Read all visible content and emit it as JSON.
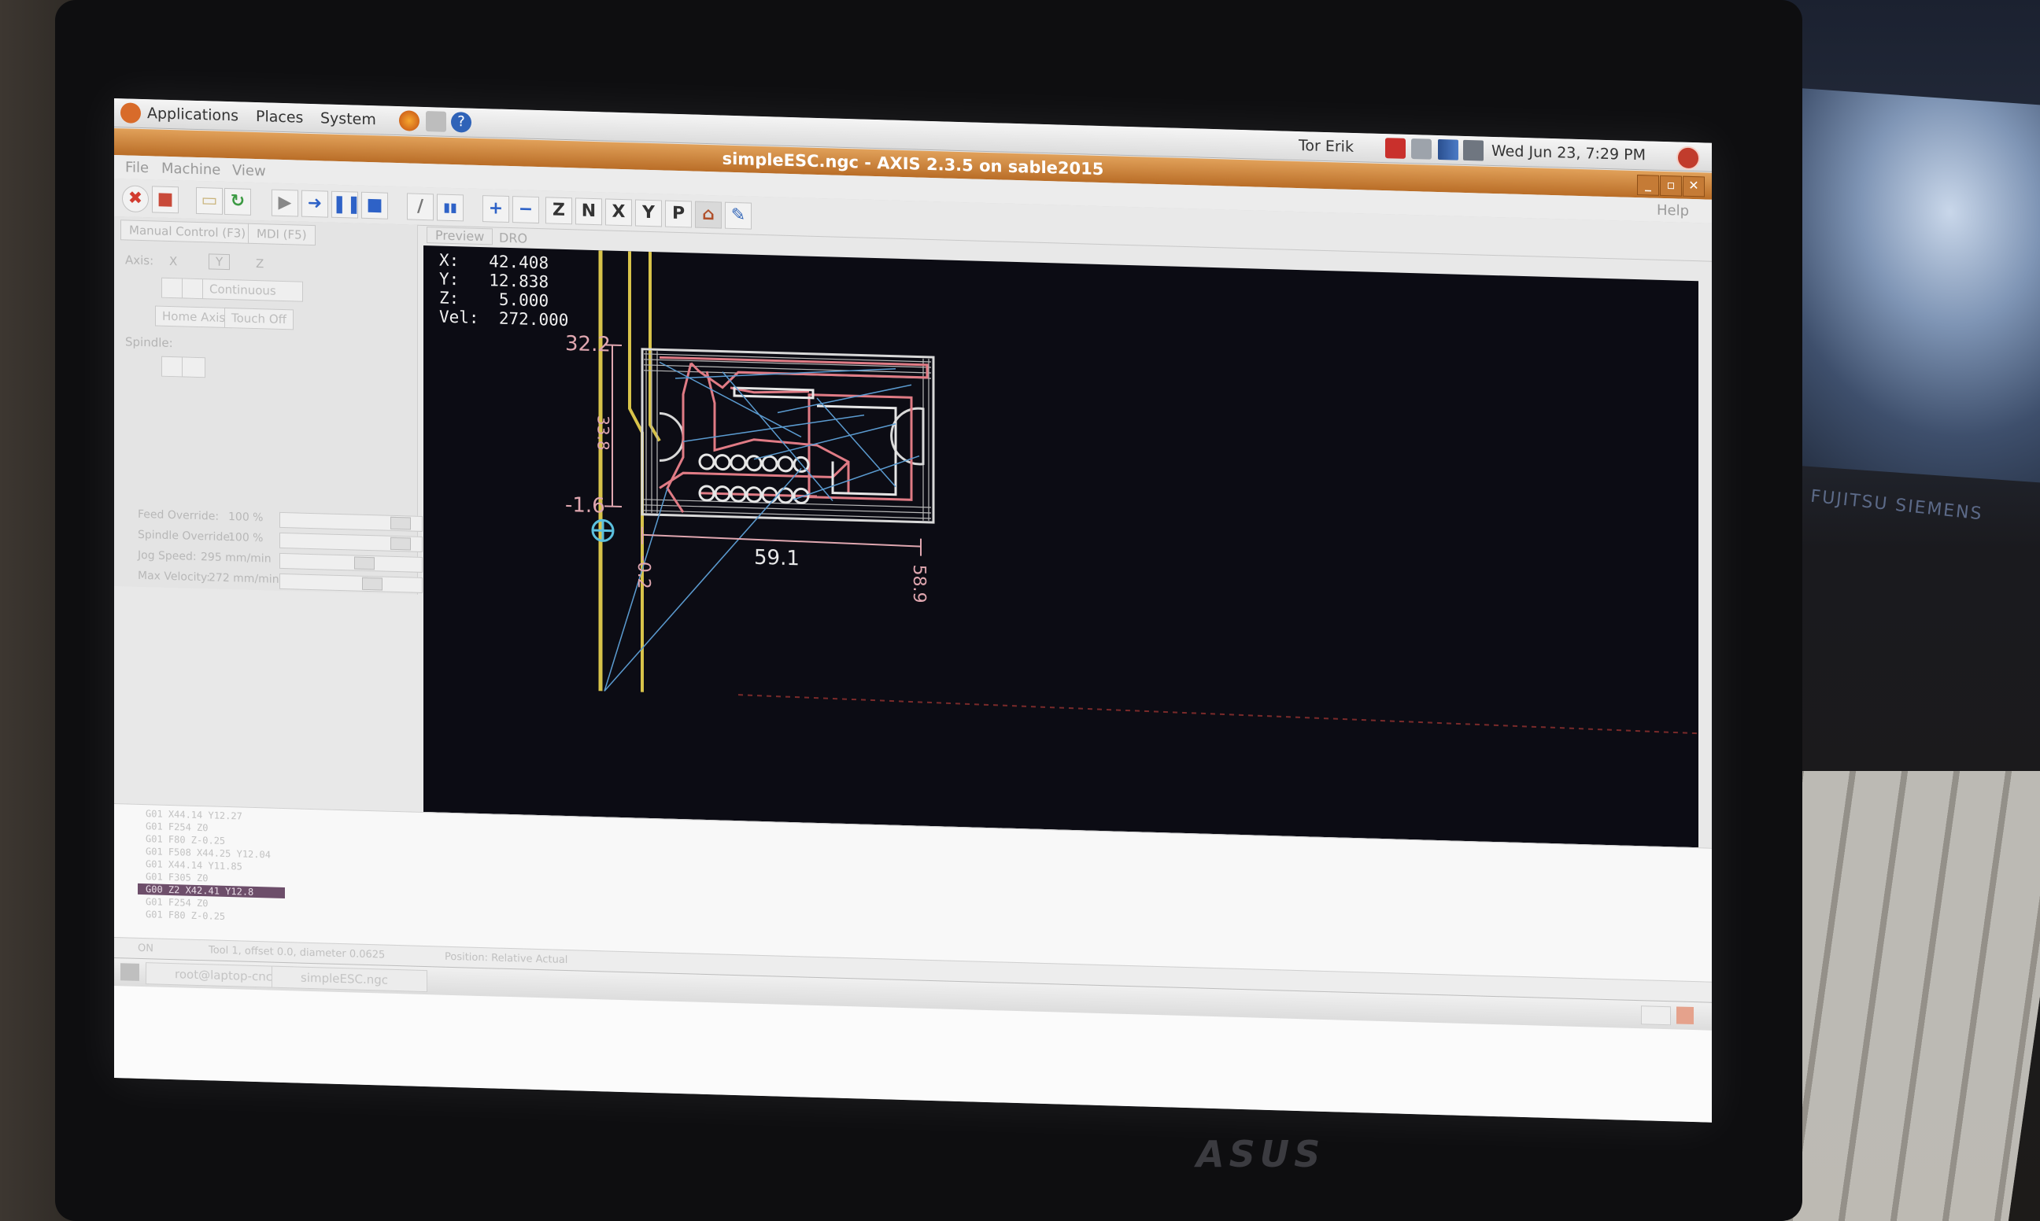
{
  "panel": {
    "menus": [
      "Applications",
      "Places",
      "System"
    ],
    "user": "Tor Erik",
    "clock": "Wed Jun 23,  7:29 PM"
  },
  "window": {
    "title": "simpleESC.ngc - AXIS 2.3.5 on sable2015",
    "menus": [
      "File",
      "Machine",
      "View"
    ],
    "help": "Help",
    "buttons": {
      "minimize": "_",
      "maximize": "▫",
      "close": "✕"
    }
  },
  "toolbar": {
    "axis_buttons": [
      "Z",
      "N",
      "X",
      "Y",
      "P"
    ]
  },
  "left_panel": {
    "tabs": [
      "Manual Control (F3)",
      "MDI (F5)"
    ],
    "axis_label": "Axis:",
    "axes": [
      "X",
      "Y",
      "Z"
    ],
    "jog_mode": "Continuous",
    "buttons": [
      "Home Axis",
      "Touch Off"
    ],
    "spindle_label": "Spindle:",
    "overrides": [
      {
        "label": "Feed Override:",
        "value": "100 %"
      },
      {
        "label": "Spindle Override:",
        "value": "100 %"
      },
      {
        "label": "Jog Speed:",
        "value": "295 mm/min"
      },
      {
        "label": "Max Velocity:",
        "value": "272 mm/min"
      }
    ]
  },
  "preview": {
    "tabs": [
      "Preview",
      "DRO"
    ],
    "dro": {
      "x_label": "X:",
      "x": "42.408",
      "y_label": "Y:",
      "y": "12.838",
      "z_label": "Z:",
      "z": "5.000",
      "vel_label": "Vel:",
      "vel": "272.000"
    },
    "dims": {
      "y_max": "32.2",
      "y_min": "-1.6",
      "y_span": "33.8",
      "x_span": "59.1",
      "x_min": "-0.2",
      "x_max": "58.9"
    },
    "colors": {
      "traces": "#e07b85",
      "rapids": "#5b9bd0",
      "toolpath": "#dcdcdc",
      "tool": "#d8c34a",
      "dims": "#e0a7b0"
    }
  },
  "gcode": [
    "G01 X44.14 Y12.27",
    "G01 F254 Z0",
    "G01 F80 Z-0.25",
    "G01 F508 X44.25 Y12.04",
    "G01 X44.14 Y11.85",
    "G01 F305 Z0",
    "G00 Z2 X42.41 Y12.8",
    "G01 F254 Z0",
    "G01 F80 Z-0.25"
  ],
  "status": {
    "state": "ON",
    "tool": "Tool 1, offset 0.0, diameter 0.0625",
    "position": "Position: Relative Actual"
  },
  "taskbar": {
    "terminal": "root@laptop-cnc: ~",
    "axis": "simpleESC.ngc"
  },
  "laptop_brand": "ASUS",
  "monitor_brand": "FUJITSU SIEMENS"
}
